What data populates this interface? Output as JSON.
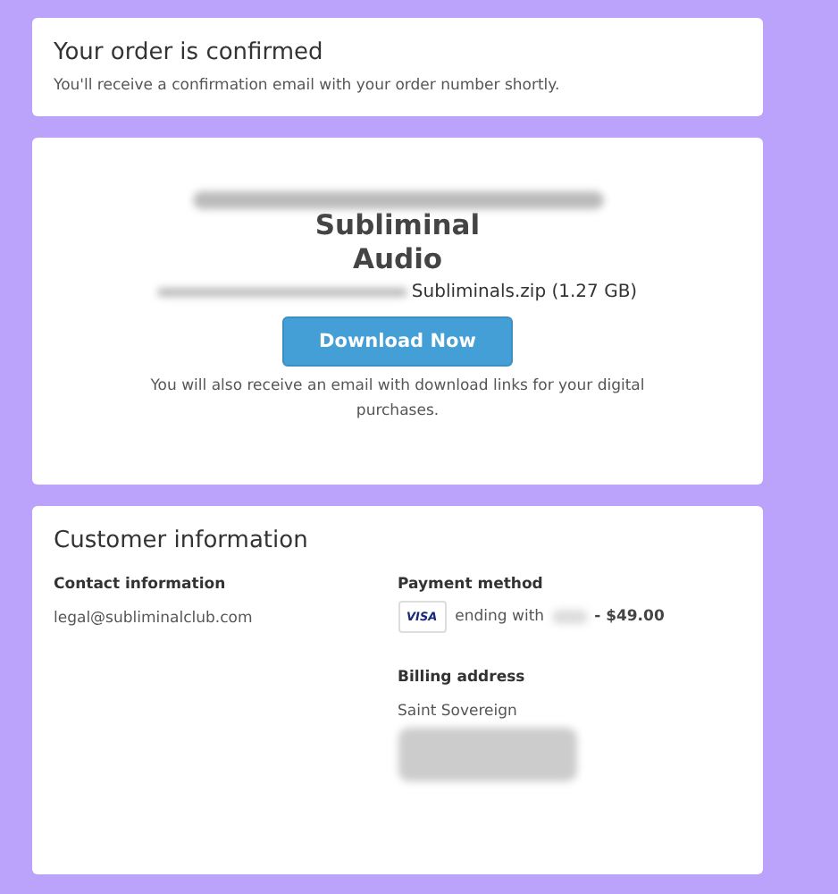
{
  "confirmation": {
    "title": "Your order is confirmed",
    "message": "You'll receive a confirmation email with your order number shortly."
  },
  "download": {
    "product_title": "Subliminal Audio",
    "file_name": "Subliminals.zip (1.27 GB)",
    "button": "Download Now",
    "note": "You will also receive an email with download links for your digital purchases."
  },
  "customer": {
    "title": "Customer information",
    "contact": {
      "heading": "Contact information",
      "email": "legal@subliminalclub.com"
    },
    "payment": {
      "heading": "Payment method",
      "card_brand": "VISA",
      "ending": "ending with",
      "amount": "- $49.00"
    },
    "billing": {
      "heading": "Billing address",
      "name": "Saint Sovereign"
    }
  }
}
